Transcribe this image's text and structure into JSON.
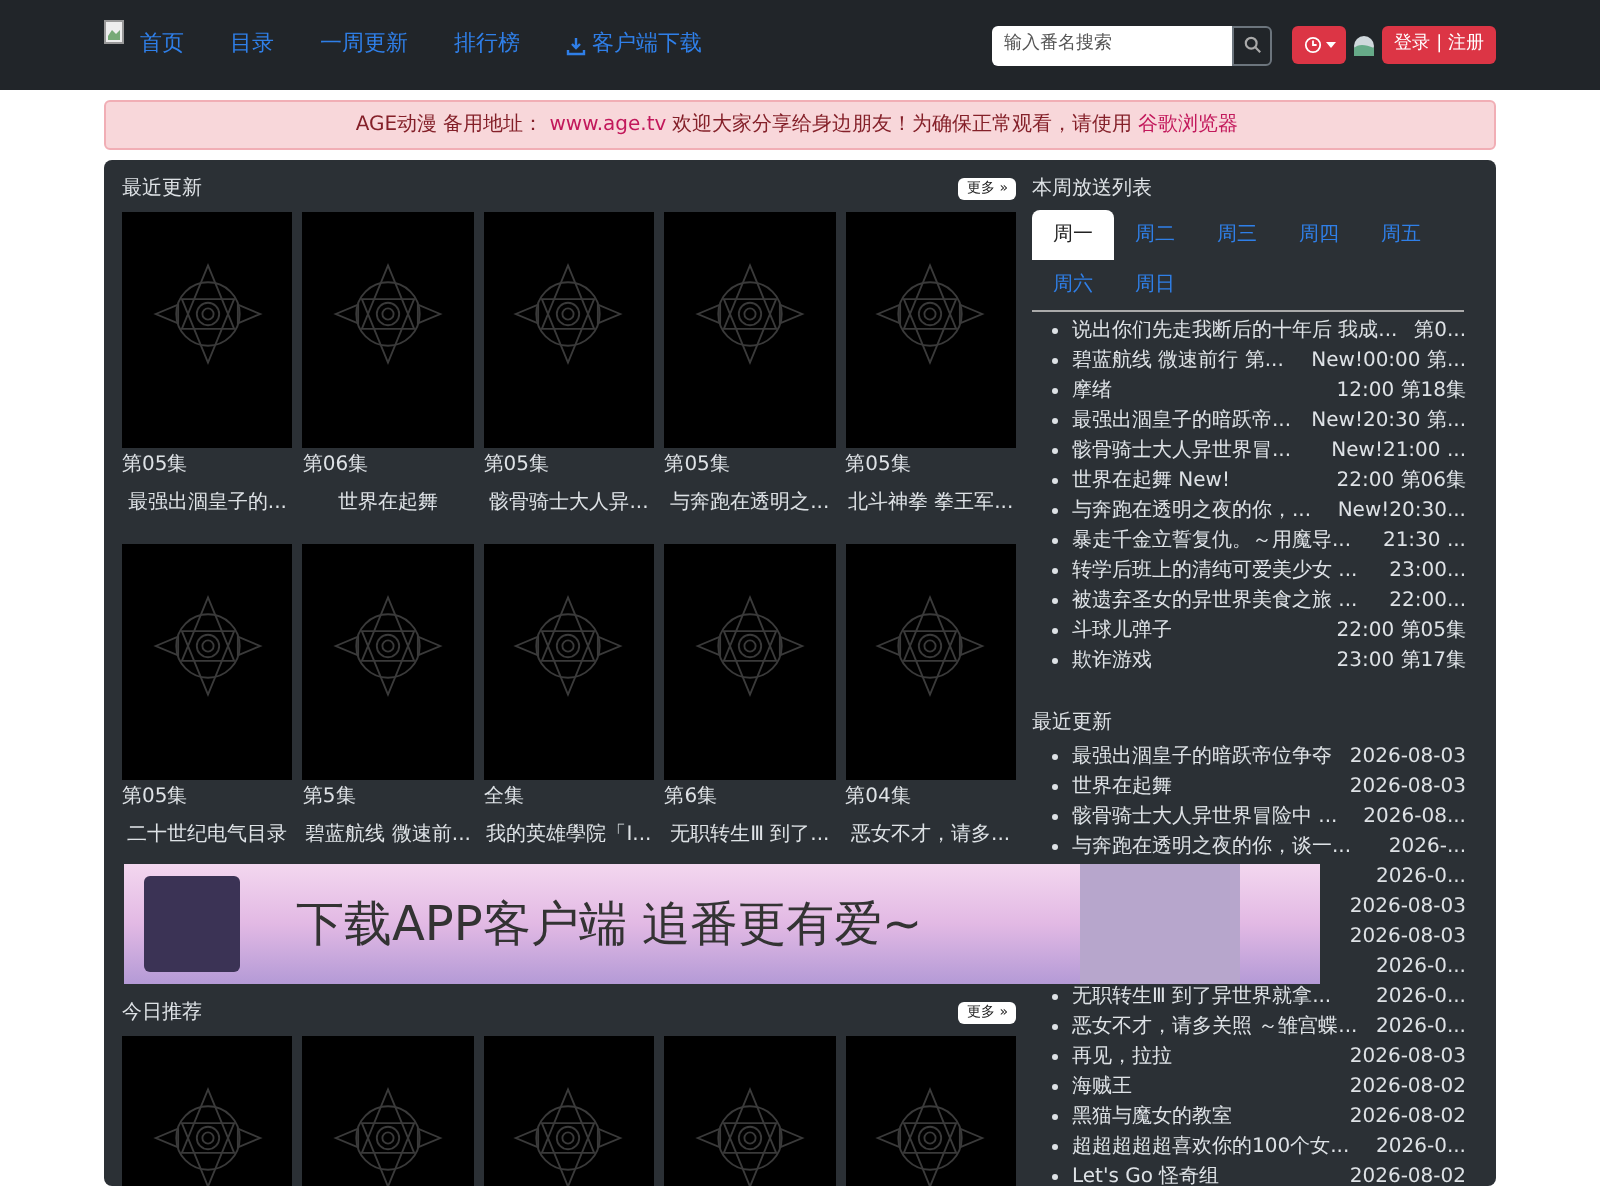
{
  "nav": {
    "links": [
      {
        "label": "首页",
        "kind": "plain"
      },
      {
        "label": "目录",
        "kind": "plain"
      },
      {
        "label": "一周更新",
        "kind": "plain"
      },
      {
        "label": "排行榜",
        "kind": "plain"
      },
      {
        "label": "客户端下载",
        "kind": "download"
      }
    ],
    "search": {
      "placeholder": "输入番名搜索"
    },
    "login": "登录 | 注册"
  },
  "notice": [
    {
      "text": "AGE动漫 备用地址：",
      "kind": "plain"
    },
    {
      "text": "www.age.tv",
      "kind": "link"
    },
    {
      "text": "欢迎大家分享给身边朋友！为确保正常观看，请使用",
      "kind": "plain"
    },
    {
      "text": "谷歌浏览器",
      "kind": "link"
    }
  ],
  "latest": {
    "title": "最近更新",
    "more": "更多 »",
    "cards": [
      {
        "episode": "第05集",
        "title": "最强出涸皇子的..."
      },
      {
        "episode": "第06集",
        "title": "世界在起舞"
      },
      {
        "episode": "第05集",
        "title": "骸骨骑士大人异..."
      },
      {
        "episode": "第05集",
        "title": "与奔跑在透明之..."
      },
      {
        "episode": "第05集",
        "title": "北斗神拳 拳王军..."
      },
      {
        "episode": "第05集",
        "title": "二十世纪电气目录"
      },
      {
        "episode": "第5集",
        "title": "碧蓝航线 微速前..."
      },
      {
        "episode": "全集",
        "title": "我的英雄學院「I..."
      },
      {
        "episode": "第6集",
        "title": "无职转生Ⅲ 到了..."
      },
      {
        "episode": "第04集",
        "title": "恶女不才，请多..."
      }
    ]
  },
  "banner": {
    "text": "下载APP客户端  追番更有爱~"
  },
  "today": {
    "title": "今日推荐",
    "more": "更多 »"
  },
  "schedule": {
    "title": "本周放送列表",
    "tabs": [
      {
        "label": "周一",
        "selected": true
      },
      {
        "label": "周二",
        "selected": false
      },
      {
        "label": "周三",
        "selected": false
      },
      {
        "label": "周四",
        "selected": false
      },
      {
        "label": "周五",
        "selected": false
      },
      {
        "label": "周六",
        "selected": false
      },
      {
        "label": "周日",
        "selected": false
      }
    ],
    "items": [
      {
        "title": "说出你们先走我断后的十年后 我成...",
        "info": "第0..."
      },
      {
        "title": "碧蓝航线 微速前行 第...",
        "info": "New!00:00 第..."
      },
      {
        "title": "摩绪",
        "info": "12:00 第18集"
      },
      {
        "title": "最强出涸皇子的暗跃帝...",
        "info": "New!20:30 第..."
      },
      {
        "title": "骸骨骑士大人异世界冒...",
        "info": "New!21:00 ..."
      },
      {
        "title": "世界在起舞  New!",
        "info": "22:00 第06集"
      },
      {
        "title": "与奔跑在透明之夜的你，...",
        "info": "New!20:30..."
      },
      {
        "title": "暴走千金立誓复仇。～用魔导...",
        "info": "21:30 ..."
      },
      {
        "title": "转学后班上的清纯可爱美少女 ...",
        "info": "23:00..."
      },
      {
        "title": "被遗弃圣女的异世界美食之旅 ...",
        "info": "22:00..."
      },
      {
        "title": "斗球儿弹子",
        "info": "22:00 第05集"
      },
      {
        "title": "欺诈游戏",
        "info": "23:00 第17集"
      }
    ]
  },
  "recent": {
    "title": "最近更新",
    "items": [
      {
        "title": "最强出涸皇子的暗跃帝位争夺",
        "date": "2026-08-03"
      },
      {
        "title": "世界在起舞",
        "date": "2026-08-03"
      },
      {
        "title": "骸骨骑士大人异世界冒险中 ...",
        "date": "2026-08..."
      },
      {
        "title": "与奔跑在透明之夜的你，谈一...",
        "date": "2026-..."
      },
      {
        "date": "2026-0..."
      },
      {
        "date": "2026-08-03"
      },
      {
        "date": "2026-08-03"
      },
      {
        "date": "2026-0..."
      },
      {
        "title": "无职转生Ⅲ 到了异世界就拿...",
        "date": "2026-0..."
      },
      {
        "title": "恶女不才，请多关照 ～雏宫蝶...",
        "date": "2026-0..."
      },
      {
        "title": "再见，拉拉",
        "date": "2026-08-03"
      },
      {
        "title": "海贼王",
        "date": "2026-08-02"
      },
      {
        "title": "黑猫与魔女的教室",
        "date": "2026-08-02"
      },
      {
        "title": "超超超超超喜欢你的100个女...",
        "date": "2026-0..."
      },
      {
        "title": "Let's Go 怪奇组",
        "date": "2026-08-02"
      }
    ]
  }
}
